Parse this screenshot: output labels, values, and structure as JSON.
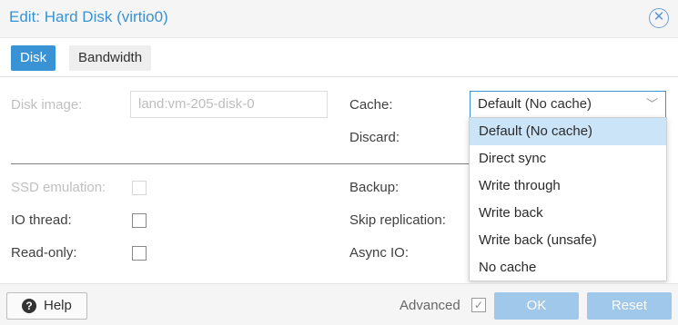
{
  "window": {
    "title": "Edit: Hard Disk (virtio0)",
    "close_icon": "close-icon"
  },
  "tabs": [
    {
      "label": "Disk",
      "active": true
    },
    {
      "label": "Bandwidth",
      "active": false
    }
  ],
  "form": {
    "disk_image": {
      "label": "Disk image:",
      "value": "land:vm-205-disk-0",
      "disabled": true
    },
    "cache": {
      "label": "Cache:",
      "value": "Default (No cache)"
    },
    "discard": {
      "label": "Discard:"
    },
    "ssd_emulation": {
      "label": "SSD emulation:",
      "checked": false,
      "disabled": true
    },
    "io_thread": {
      "label": "IO thread:",
      "checked": false
    },
    "read_only": {
      "label": "Read-only:",
      "checked": false
    },
    "backup": {
      "label": "Backup:"
    },
    "skip_replication": {
      "label": "Skip replication:"
    },
    "async_io": {
      "label": "Async IO:"
    }
  },
  "cache_dropdown": {
    "options": [
      "Default (No cache)",
      "Direct sync",
      "Write through",
      "Write back",
      "Write back (unsafe)",
      "No cache"
    ],
    "selected": "Default (No cache)"
  },
  "footer": {
    "help_label": "Help",
    "advanced_label": "Advanced",
    "advanced_checked": true,
    "ok_label": "OK",
    "reset_label": "Reset"
  },
  "colors": {
    "accent": "#3892d4",
    "disabled_button": "#9fc8ea",
    "selected_option": "#cce4f7"
  }
}
